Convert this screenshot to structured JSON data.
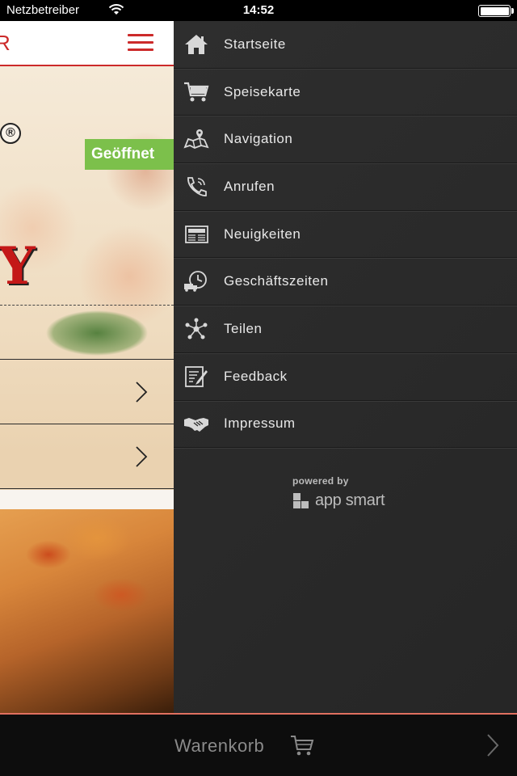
{
  "status_bar": {
    "carrier": "Netzbetreiber",
    "time": "14:52"
  },
  "main": {
    "header_partial": "R",
    "restaurant_status": "Geöffnet",
    "registered_mark": "®",
    "logo_partial": "Y"
  },
  "menu": {
    "items": [
      {
        "label": "Startseite",
        "icon": "home-icon"
      },
      {
        "label": "Speisekarte",
        "icon": "cart-icon"
      },
      {
        "label": "Navigation",
        "icon": "map-icon"
      },
      {
        "label": "Anrufen",
        "icon": "phone-icon"
      },
      {
        "label": "Neuigkeiten",
        "icon": "news-icon"
      },
      {
        "label": "Geschäftszeiten",
        "icon": "clock-truck-icon"
      },
      {
        "label": "Teilen",
        "icon": "share-icon"
      },
      {
        "label": "Feedback",
        "icon": "feedback-icon"
      },
      {
        "label": "Impressum",
        "icon": "handshake-icon"
      }
    ],
    "powered_by": "powered by",
    "brand": "app smart"
  },
  "bottom_bar": {
    "cart_label": "Warenkorb"
  },
  "colors": {
    "accent_red": "#cc2a2a",
    "open_green": "#7cc04b",
    "menu_bg": "#2a2a2a",
    "menu_text": "#e8e8e8"
  }
}
